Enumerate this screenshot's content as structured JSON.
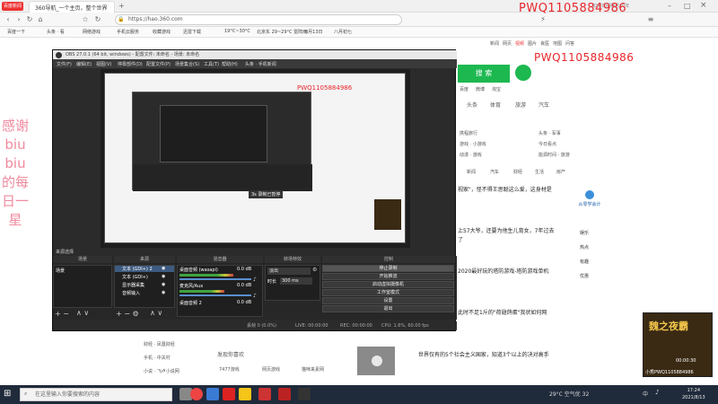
{
  "browser": {
    "tabs": [
      {
        "label": "360导航_一个主页，整个世界",
        "active": true
      },
      {
        "label": "",
        "active": false
      }
    ],
    "url": "https://hao.360.com",
    "top_badge": "百度新闻",
    "right_promo": "如何找回腾讯10年"
  },
  "bookmarks": [
    "百度一下",
    "头条 · 看",
    "网络游戏",
    "手机云服务",
    "收藏游戏",
    "迅雷下载",
    "19°C~30°C",
    "北京东 29~29°C 雷阵雨",
    "8月13日",
    "八月初七"
  ],
  "watermark": {
    "top": "PWQ1105884986",
    "mid": "PWQ1105884986",
    "obs_overlay": "PWQ1105884986",
    "thanks": "感谢biubiu的每日一星"
  },
  "page360": {
    "search_button": "搜 索",
    "top_links": [
      "新闻",
      "网页",
      "视频",
      "图片",
      "良医",
      "地图",
      "问答",
      "软件"
    ],
    "channels": [
      "头条",
      "体育",
      "旅游",
      "汽车"
    ],
    "subchannels": [
      "百度",
      "微博",
      "淘宝"
    ],
    "side_items": [
      "携程旅行",
      "头条 · 军事",
      "游戏 · 小游戏",
      "今日看点",
      "动漫 · 游戏",
      "能源时间 · 旅游"
    ],
    "news": [
      {
        "text": "视家\"，怪不得王思聪这么爱，这身材是"
      },
      {
        "text": "上57大爷，还要为他生儿育女，7年过去"
      },
      {
        "text": "了"
      },
      {
        "text": "2020最好玩的塔防游戏-塔防游戏单机"
      },
      {
        "text": "此时不足1斤的\"荷翅鸽蛋\"我状如何网"
      },
      {
        "text": "世界仅有的5个社会主义国家，知道3个以上的决对高手"
      }
    ],
    "section_links": [
      "新闻",
      "体育",
      "汽车",
      "财经",
      "生活",
      "房产"
    ],
    "bottom_items": [
      "财经 · 凤凰财经",
      "手机 · 中关村",
      "小说 · 飞卢小说网",
      "发现你喜欢",
      "7477游戏",
      "网页游戏",
      "猫咪来素网"
    ],
    "sidebar": {
      "title": "从零学会计",
      "items": [
        "娱乐",
        "热点",
        "有趣",
        "优惠"
      ]
    }
  },
  "obs": {
    "title": "OBS 27.0.1 (64 bit, windows) - 配置文件: 未命名 - 场景: 未命名",
    "menu": [
      "文件(F)",
      "编辑(E)",
      "视图(V)",
      "停靠部件(D)",
      "配置文件(P)",
      "场景集合(S)",
      "工具(T)",
      "帮助(H)",
      "头条 · 手机新闻"
    ],
    "preview_note": "3s 录制已暂停",
    "docks": {
      "scenes": "场景",
      "sources": "来源",
      "mixer": "混音器",
      "transitions": "转场特效",
      "controls": "控制"
    },
    "scene_list": [
      "场景"
    ],
    "source_list": [
      {
        "label": "文本 (GDI+) 2"
      },
      {
        "label": "文本 (GDI+)"
      },
      {
        "label": "显示器采集"
      },
      {
        "label": "音频输入"
      }
    ],
    "mixer": [
      {
        "label": "桌面音频 (wasapi)",
        "db": "0.0 dB"
      },
      {
        "label": "麦克风/Aux",
        "db": "0.0 dB"
      },
      {
        "label": "桌面音频 2",
        "db": "0.0 dB"
      }
    ],
    "transition": {
      "type": "淡出",
      "duration_label": "时长",
      "duration": "300 ms"
    },
    "controls": [
      "停止录制",
      "开始推流",
      "启动虚拟摄像机",
      "工作室模式",
      "设置",
      "退出"
    ],
    "status": {
      "live": "LIVE: 00:00:00",
      "rec": "REC: 00:00:00",
      "cpu": "CPU: 1.6%, 60.00 fps",
      "dropped": "丢帧 0 (0.0%)"
    },
    "scene_header": "来源选择"
  },
  "taskbar": {
    "search_placeholder": "在这里输入你要搜索的内容",
    "weather": "29°C 空气优 32",
    "time": "17:24",
    "date": "2021/8/13",
    "lang": "中"
  },
  "video_thumb": {
    "title": "魏之夜霸",
    "time": "00:00:30",
    "url": "小秀PWQ1105884986"
  },
  "colors": {
    "watermark": "#e8262b",
    "thanks": "#f08a9e",
    "accent_green": "#1db850",
    "obs_bg": "#2b2b2b"
  }
}
